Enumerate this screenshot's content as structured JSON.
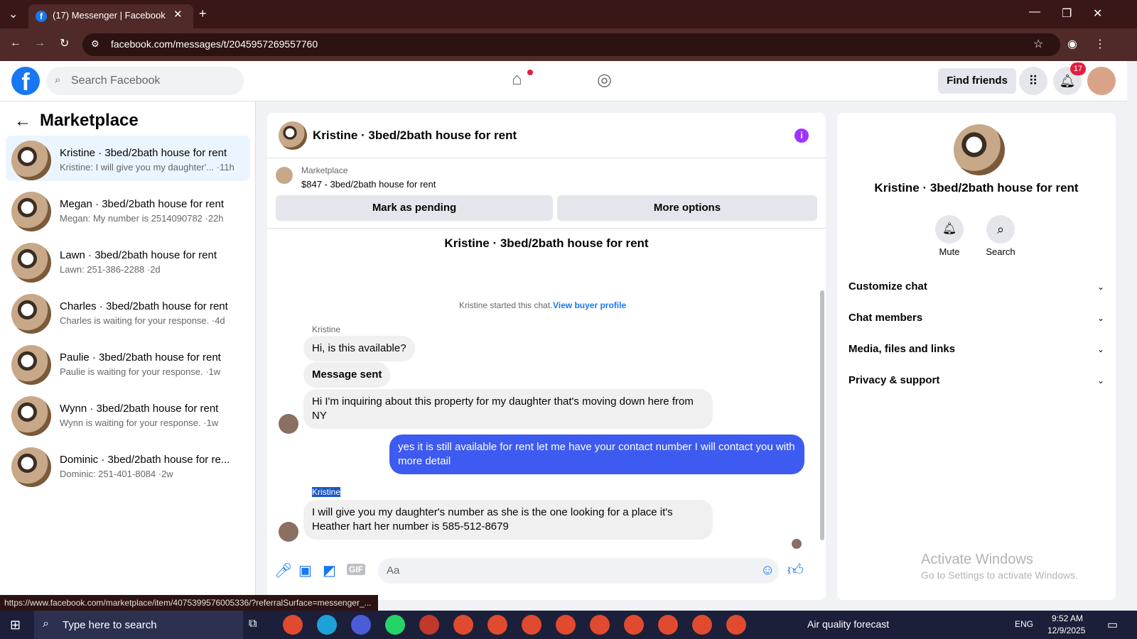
{
  "browser": {
    "tab_title": "(17) Messenger | Facebook",
    "url": "facebook.com/messages/t/2045957269557760"
  },
  "header": {
    "search_placeholder": "Search Facebook",
    "find_friends": "Find friends",
    "notif_count": "17"
  },
  "sidebar": {
    "title": "Marketplace",
    "conversations": [
      {
        "name": "Kristine · 3bed/2bath house for rent",
        "preview": "Kristine: I will give you my daughter'... ·11h"
      },
      {
        "name": "Megan · 3bed/2bath house for rent",
        "preview": "Megan: My number is 2514090782 ·22h"
      },
      {
        "name": "Lawn · 3bed/2bath house for rent",
        "preview": "Lawn: 251-386-2288 ·2d"
      },
      {
        "name": "Charles · 3bed/2bath house for rent",
        "preview": "Charles is waiting for your response. ·4d"
      },
      {
        "name": "Paulie · 3bed/2bath house for rent",
        "preview": "Paulie is waiting for your response. ·1w"
      },
      {
        "name": "Wynn · 3bed/2bath house for rent",
        "preview": "Wynn is waiting for your response. ·1w"
      },
      {
        "name": "Dominic · 3bed/2bath house for re...",
        "preview": "Dominic: 251-401-8084 ·2w"
      }
    ]
  },
  "chat": {
    "title": "Kristine · 3bed/2bath house for rent",
    "listing_label": "Marketplace",
    "listing": "$847 - 3bed/2bath house for rent",
    "mark_pending": "Mark as pending",
    "more_options": "More options",
    "intro_name": "Kristine · 3bed/2bath house for rent",
    "started": "Kristine started this chat.",
    "view_profile": "View buyer profile",
    "sender1": "Kristine",
    "msg1": "Hi, is this available?",
    "msg2": "Message sent",
    "msg3": "Hi I'm inquiring about this property for my daughter that's moving down here from NY",
    "msg4": "yes it is still available for rent let me have your contact number I will contact you with more detail",
    "sender2": "Kristine",
    "msg5": "I will give you my daughter's number as she is the one looking for a place it's Heather hart her number is 585-512-8679",
    "composer_placeholder": "Aa"
  },
  "info": {
    "name": "Kristine · 3bed/2bath house for rent",
    "mute": "Mute",
    "search": "Search",
    "sections": [
      "Customize chat",
      "Chat members",
      "Media, files and links",
      "Privacy & support"
    ],
    "watermark1": "Activate Windows",
    "watermark2": "Go to Settings to activate Windows."
  },
  "status_url": "https://www.facebook.com/marketplace/item/4075399576005336/?referralSurface=messenger_...",
  "taskbar": {
    "search_placeholder": "Type here to search",
    "weather": "Air quality forecast",
    "lang": "ENG",
    "time": "9:52 AM",
    "date": "12/9/2025"
  }
}
